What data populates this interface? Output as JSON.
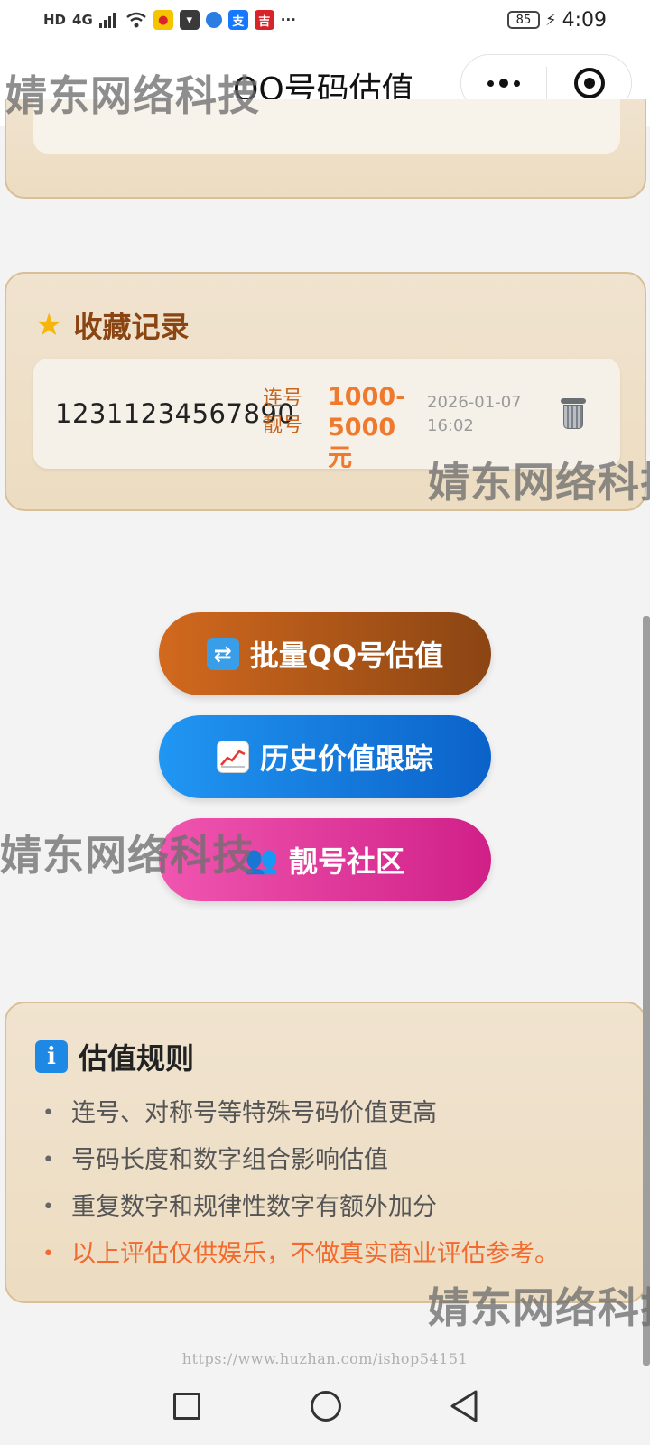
{
  "status_bar": {
    "network_badges": [
      "HD",
      "4G"
    ],
    "time": "4:09",
    "battery": "85",
    "more": "···"
  },
  "header": {
    "title": "QQ号码估值"
  },
  "watermark": "婧东网络科技",
  "favorites": {
    "title": "收藏记录",
    "items": [
      {
        "number": "12311234567890",
        "tag": "连号 靓号",
        "value": "1000-5000元",
        "date": "2026-01-07 16:02"
      }
    ]
  },
  "buttons": {
    "batch": "批量QQ号估值",
    "history": "历史价值跟踪",
    "community": "靓号社区"
  },
  "rules": {
    "title": "估值规则",
    "items": [
      "连号、对称号等特殊号码价值更高",
      "号码长度和数字组合影响估值",
      "重复数字和规律性数字有额外加分",
      "以上评估仅供娱乐，不做真实商业评估参考。"
    ]
  },
  "footer_url": "https://www.huzhan.com/ishop54151",
  "colors": {
    "card_bg": "#efe1cb",
    "card_border": "#d8bf98",
    "accent_brown": "#8b4513",
    "accent_orange": "#ef7a2e",
    "btn_batch": "#b85a1c",
    "btn_history": "#1a7fe6",
    "btn_community": "#e03a9e"
  },
  "icons": {
    "favorites": "star-icon",
    "batch": "sync-icon",
    "history": "chart-icon",
    "community": "people-icon",
    "rules": "info-icon",
    "delete": "trash-icon"
  }
}
